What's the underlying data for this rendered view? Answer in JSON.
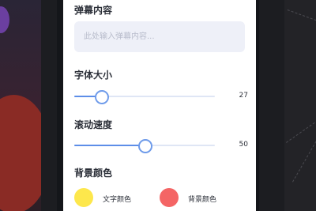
{
  "content": {
    "heading": "弹幕内容",
    "placeholder": "此处输入弹幕内容..."
  },
  "font_size": {
    "heading": "字体大小",
    "value": 27,
    "fraction": 0.19
  },
  "scroll_speed": {
    "heading": "滚动速度",
    "value": 50,
    "fraction": 0.5
  },
  "background": {
    "heading": "背景颜色",
    "text_color_label": "文字颜色",
    "text_color": "#fde74c",
    "bg_color_label": "背景颜色",
    "bg_color": "#f46565"
  },
  "colors": {
    "accent": "#5d8ee8"
  }
}
